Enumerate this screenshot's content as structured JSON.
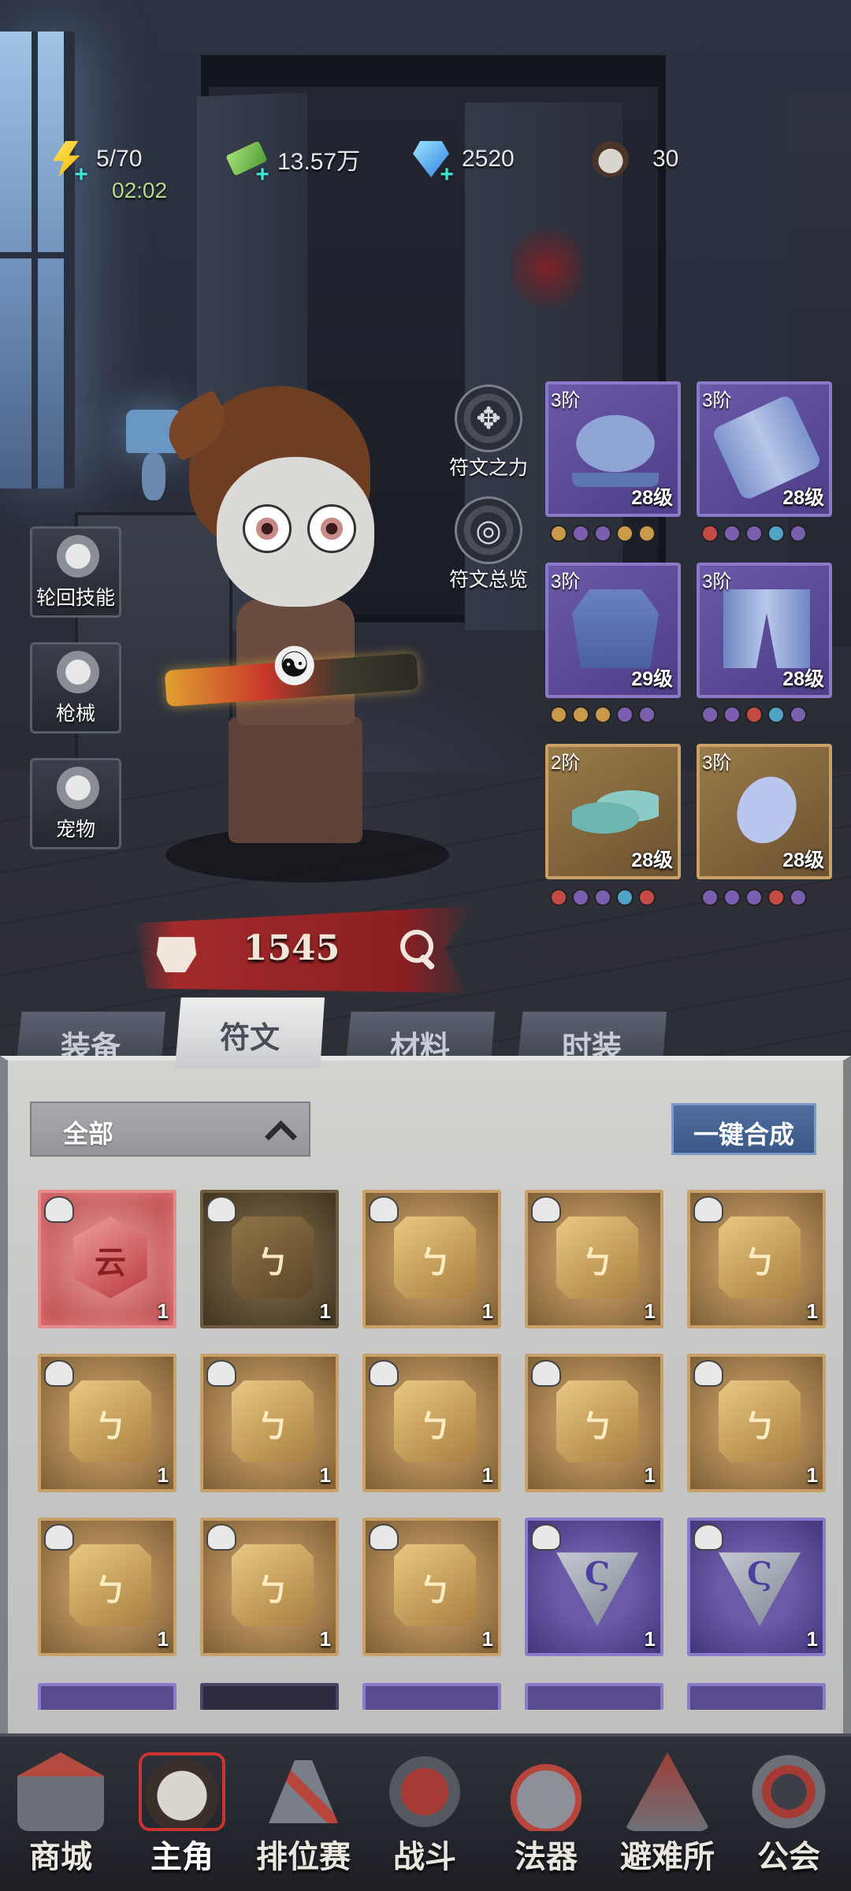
{
  "resources": {
    "energy": {
      "icon": "lightning-icon",
      "value": "5/70",
      "timer": "02:02"
    },
    "cash": {
      "icon": "cash-icon",
      "value": "13.57万"
    },
    "gems": {
      "icon": "diamond-icon",
      "value": "2520"
    },
    "hero_shards": {
      "icon": "hero-face-icon",
      "value": "30"
    }
  },
  "side_menu": [
    {
      "key": "reincarnation",
      "label": "轮回技能",
      "icon": "eye-swirl-icon"
    },
    {
      "key": "firearms",
      "label": "枪械",
      "icon": "revolver-icon"
    },
    {
      "key": "pets",
      "label": "宠物",
      "icon": "pet-icon"
    }
  ],
  "rune_buttons": [
    {
      "key": "rune_power",
      "label": "符文之力",
      "icon": "rune-power-icon"
    },
    {
      "key": "rune_overview",
      "label": "符文总览",
      "icon": "rune-overview-icon"
    }
  ],
  "equipment": [
    {
      "slot": "hat",
      "tier": "3阶",
      "level": "28级",
      "rarity": "purple",
      "gems": [
        "#c89a4a",
        "#7a5fb0",
        "#7a5fb0",
        "#c89a4a",
        "#c89a4a"
      ]
    },
    {
      "slot": "armguard",
      "tier": "3阶",
      "level": "28级",
      "rarity": "purple",
      "gems": [
        "#c44a44",
        "#7a5fb0",
        "#7a5fb0",
        "#4fa3c4",
        "#7a5fb0"
      ]
    },
    {
      "slot": "coat",
      "tier": "3阶",
      "level": "29级",
      "rarity": "purple",
      "gems": [
        "#c89a4a",
        "#c89a4a",
        "#c89a4a",
        "#7a5fb0",
        "#7a5fb0"
      ]
    },
    {
      "slot": "pants",
      "tier": "3阶",
      "level": "28级",
      "rarity": "purple",
      "gems": [
        "#7a5fb0",
        "#7a5fb0",
        "#c44a44",
        "#4fa3c4",
        "#7a5fb0"
      ]
    },
    {
      "slot": "shoes",
      "tier": "2阶",
      "level": "28级",
      "rarity": "gold",
      "gems": [
        "#c44a44",
        "#7a5fb0",
        "#7a5fb0",
        "#4fa3c4",
        "#c44a44"
      ]
    },
    {
      "slot": "gloves",
      "tier": "3阶",
      "level": "28级",
      "rarity": "gold",
      "gems": [
        "#7a5fb0",
        "#7a5fb0",
        "#7a5fb0",
        "#c44a44",
        "#7a5fb0"
      ]
    }
  ],
  "power": {
    "value": "1545"
  },
  "tabs": [
    {
      "key": "gear",
      "label": "装备",
      "active": false
    },
    {
      "key": "runes",
      "label": "符文",
      "active": true
    },
    {
      "key": "materials",
      "label": "材料",
      "active": false
    },
    {
      "key": "fashion",
      "label": "时装",
      "active": false
    }
  ],
  "filter": {
    "label": "全部"
  },
  "merge_button": {
    "label": "一键合成"
  },
  "runes": [
    {
      "rarity": "red",
      "count": "1",
      "glyph": "云"
    },
    {
      "rarity": "gold-dim",
      "count": "1",
      "glyph": "ㄅ"
    },
    {
      "rarity": "gold",
      "count": "1",
      "glyph": "ㄅ"
    },
    {
      "rarity": "gold",
      "count": "1",
      "glyph": "ㄅ"
    },
    {
      "rarity": "gold",
      "count": "1",
      "glyph": "ㄅ"
    },
    {
      "rarity": "gold",
      "count": "1",
      "glyph": "ㄅ"
    },
    {
      "rarity": "gold",
      "count": "1",
      "glyph": "ㄅ"
    },
    {
      "rarity": "gold",
      "count": "1",
      "glyph": "ㄅ"
    },
    {
      "rarity": "gold",
      "count": "1",
      "glyph": "ㄅ"
    },
    {
      "rarity": "gold",
      "count": "1",
      "glyph": "ㄅ"
    },
    {
      "rarity": "gold",
      "count": "1",
      "glyph": "ㄅ"
    },
    {
      "rarity": "gold",
      "count": "1",
      "glyph": "ㄅ"
    },
    {
      "rarity": "gold",
      "count": "1",
      "glyph": "ㄅ"
    },
    {
      "rarity": "purple",
      "count": "1",
      "glyph": "Ϛ"
    },
    {
      "rarity": "purple",
      "count": "1",
      "glyph": "Ϛ"
    }
  ],
  "bottom_nav": [
    {
      "key": "shop",
      "label": "商城",
      "icon": "shop-icon",
      "active": false
    },
    {
      "key": "hero",
      "label": "主角",
      "icon": "hero-icon",
      "active": true
    },
    {
      "key": "ranked",
      "label": "排位赛",
      "icon": "ranked-icon",
      "active": false
    },
    {
      "key": "battle",
      "label": "战斗",
      "icon": "battle-icon",
      "active": false
    },
    {
      "key": "artifact",
      "label": "法器",
      "icon": "artifact-icon",
      "active": false
    },
    {
      "key": "shelter",
      "label": "避难所",
      "icon": "shelter-icon",
      "active": false
    },
    {
      "key": "guild",
      "label": "公会",
      "icon": "guild-icon",
      "active": false
    }
  ]
}
